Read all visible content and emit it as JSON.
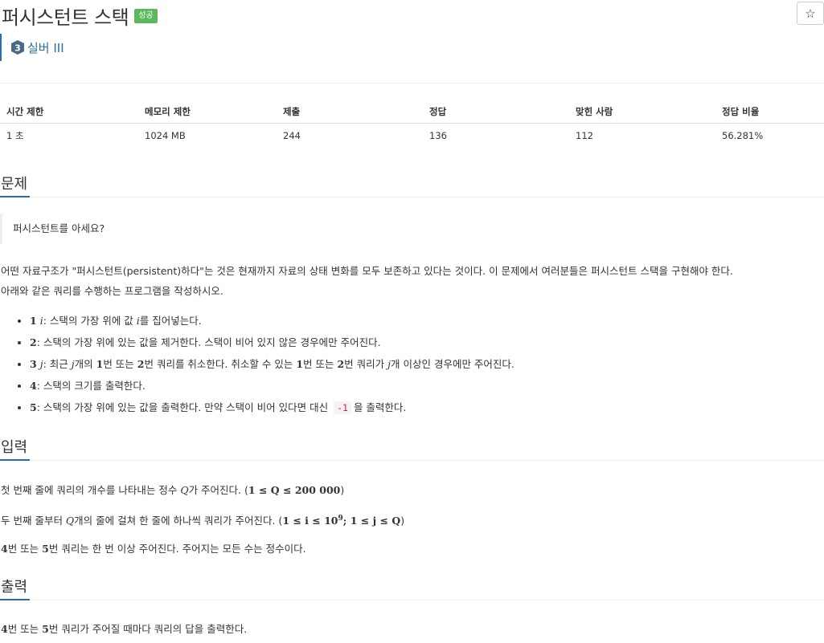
{
  "problem": {
    "title": "퍼시스턴트 스택",
    "badge": "성공",
    "star": "☆",
    "tier": {
      "number": "3",
      "label": "실버 III",
      "color": "#4a6a8a"
    }
  },
  "info_table": {
    "headers": [
      "시간 제한",
      "메모리 제한",
      "제출",
      "정답",
      "맞힌 사람",
      "정답 비율"
    ],
    "values": [
      "1 초",
      "1024 MB",
      "244",
      "136",
      "112",
      "56.281%"
    ]
  },
  "sections": {
    "problem_heading": "문제",
    "input_heading": "입력",
    "output_heading": "출력"
  },
  "statement": {
    "quote": "퍼시스턴트를 아세요?",
    "para1_line1": "어떤 자료구조가 \"퍼시스턴트(persistent)하다\"는 것은 현재까지 자료의 상태 변화를 모두 보존하고 있다는 것이다. 이 문제에서 여러분들은 퍼시스턴트 스택을 구현해야 한다.",
    "para1_line2": "아래와 같은 쿼리를 수행하는 프로그램을 작성하시오."
  },
  "queries": [
    {
      "num": "1",
      "var": "i",
      "text_a": ": 스택의 가장 위에 값 ",
      "var2": "i",
      "text_b": "를 집어넣는다."
    },
    {
      "num": "2",
      "text": ": 스택의 가장 위에 있는 값을 제거한다. 스택이 비어 있지 않은 경우에만 주어진다."
    },
    {
      "num": "3",
      "var": "j",
      "text_a": ": 최근 ",
      "var2": "j",
      "text_b": "개의 ",
      "n1": "1",
      "text_c": "번 또는 ",
      "n2": "2",
      "text_d": "번 쿼리를 취소한다. 취소할 수 있는 ",
      "n3": "1",
      "text_e": "번 또는 ",
      "n4": "2",
      "text_f": "번 쿼리가 ",
      "var3": "j",
      "text_g": "개 이상인 경우에만 주어진다."
    },
    {
      "num": "4",
      "text": ": 스택의 크기를 출력한다."
    },
    {
      "num": "5",
      "text_a": ": 스택의 가장 위에 있는 값을 출력한다. 만약 스택이 비어 있다면 대신 ",
      "code": "-1",
      "text_b": "을 출력한다."
    }
  ],
  "input": {
    "line1_a": "첫 번째 줄에 쿼리의 개수를 나타내는 정수 ",
    "line1_var": "Q",
    "line1_b": "가 주어진다. (",
    "line1_math": "1 ≤ Q ≤ 200 000",
    "line1_c": ")",
    "line2_a": "두 번째 줄부터 ",
    "line2_var": "Q",
    "line2_b": "개의 줄에 걸쳐 한 줄에 하나씩 쿼리가 주어진다. (",
    "line2_math": "1 ≤ i ≤ 10",
    "line2_sup": "9",
    "line2_math2": "; 1 ≤ j ≤ Q",
    "line2_c": ")",
    "line3_n1": "4",
    "line3_a": "번 또는 ",
    "line3_n2": "5",
    "line3_b": "번 쿼리는 한 번 이상 주어진다. 주어지는 모든 수는 정수이다."
  },
  "output": {
    "n1": "4",
    "a": "번 또는 ",
    "n2": "5",
    "b": "번 쿼리가 주어질 때마다 쿼리의 답을 출력한다."
  }
}
